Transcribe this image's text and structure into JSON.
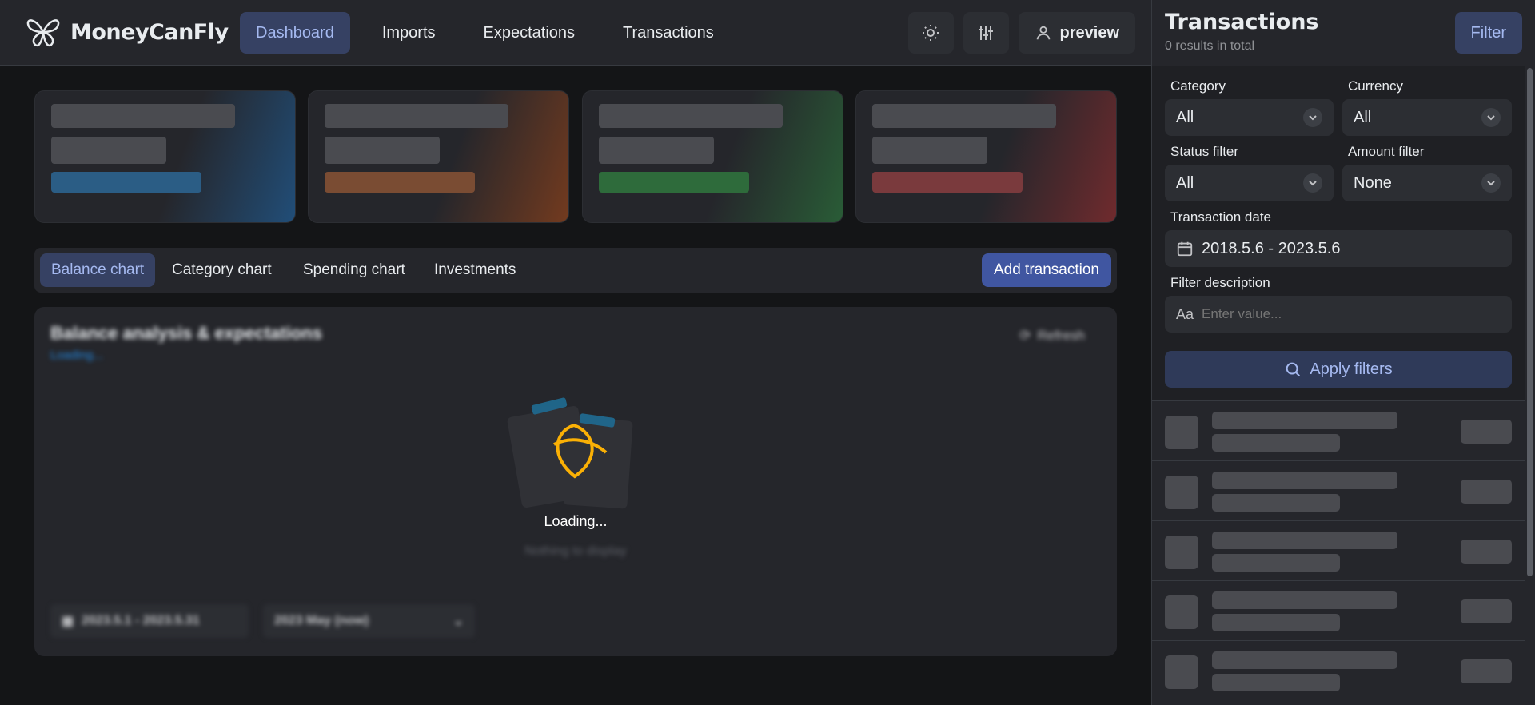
{
  "app": {
    "name": "MoneyCanFly"
  },
  "nav": {
    "items": [
      {
        "label": "Dashboard",
        "active": true
      },
      {
        "label": "Imports"
      },
      {
        "label": "Expectations"
      },
      {
        "label": "Transactions"
      }
    ]
  },
  "header": {
    "user_label": "preview",
    "icons": [
      "sun-icon",
      "sliders-icon",
      "user-icon"
    ]
  },
  "stat_cards": [
    {
      "accent": "#1c7ed6"
    },
    {
      "accent": "#e8590c"
    },
    {
      "accent": "#2f9e44"
    },
    {
      "accent": "#e03131"
    }
  ],
  "tabs": {
    "items": [
      {
        "label": "Balance chart",
        "active": true
      },
      {
        "label": "Category chart"
      },
      {
        "label": "Spending chart"
      },
      {
        "label": "Investments"
      }
    ],
    "add_label": "Add transaction"
  },
  "chart_panel": {
    "title": "Balance analysis & expectations",
    "subtitle": "Loading...",
    "refresh_label": "Refresh",
    "loading_text": "Loading...",
    "empty_text": "Nothing to display",
    "date_range": "2023.5.1 - 2023.5.31",
    "period": "2023 May (now)"
  },
  "side": {
    "title": "Transactions",
    "subtitle": "0 results in total",
    "filter_label": "Filter",
    "filters": {
      "category": {
        "label": "Category",
        "value": "All"
      },
      "currency": {
        "label": "Currency",
        "value": "All"
      },
      "status": {
        "label": "Status filter",
        "value": "All"
      },
      "amount": {
        "label": "Amount filter",
        "value": "None"
      },
      "date": {
        "label": "Transaction date",
        "value": "2018.5.6 - 2023.5.6"
      },
      "description": {
        "label": "Filter description",
        "placeholder": "Enter value...",
        "icon_text": "Aa"
      }
    },
    "apply_label": "Apply filters"
  }
}
